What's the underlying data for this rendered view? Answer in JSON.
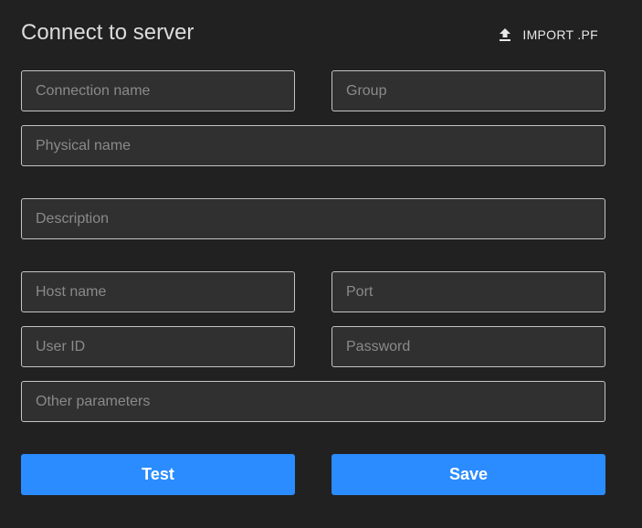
{
  "header": {
    "title": "Connect to server",
    "import_label": "IMPORT .PF",
    "import_icon": "upload-icon"
  },
  "fields": {
    "connection_name": {
      "placeholder": "Connection name",
      "value": ""
    },
    "group": {
      "placeholder": "Group",
      "value": ""
    },
    "physical_name": {
      "placeholder": "Physical name",
      "value": ""
    },
    "description": {
      "placeholder": "Description",
      "value": ""
    },
    "host_name": {
      "placeholder": "Host name",
      "value": ""
    },
    "port": {
      "placeholder": "Port",
      "value": ""
    },
    "user_id": {
      "placeholder": "User ID",
      "value": ""
    },
    "password": {
      "placeholder": "Password",
      "value": ""
    },
    "other_parameters": {
      "placeholder": "Other parameters",
      "value": ""
    }
  },
  "actions": {
    "test_label": "Test",
    "save_label": "Save"
  },
  "colors": {
    "background": "#212121",
    "field_background": "#303030",
    "field_border": "#c4c4c4",
    "accent": "#2a8cff"
  }
}
